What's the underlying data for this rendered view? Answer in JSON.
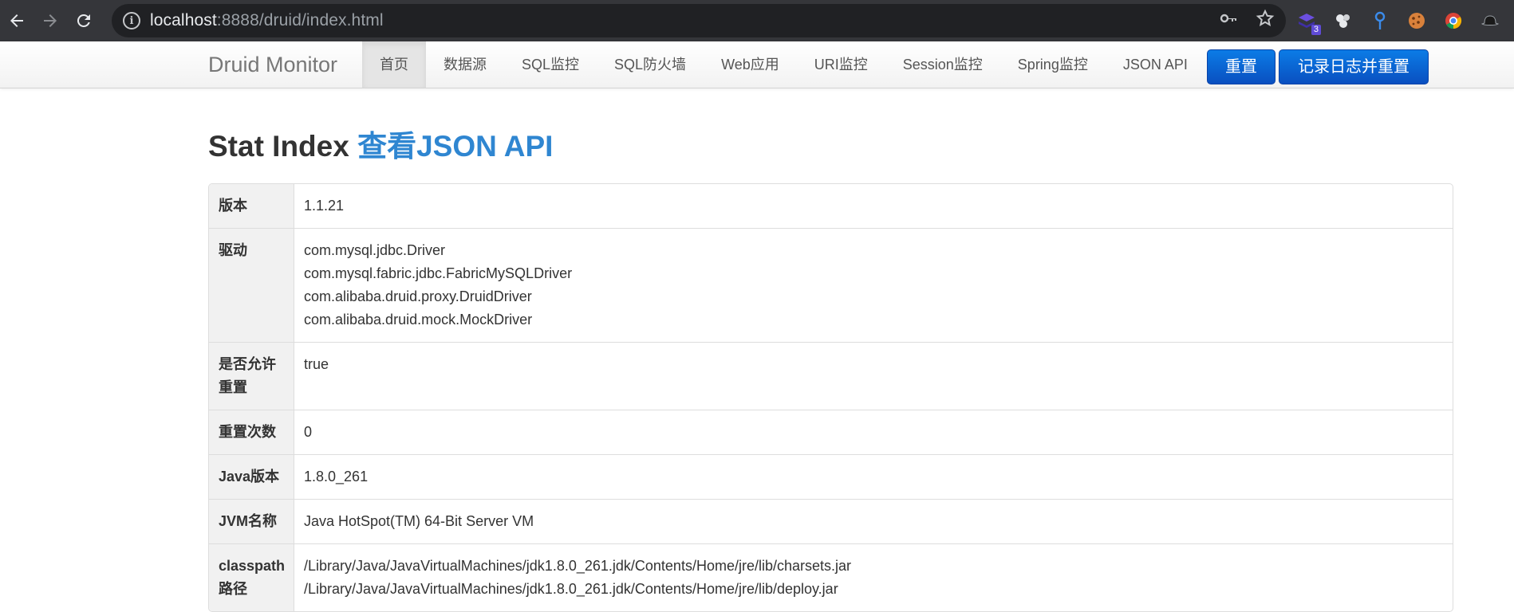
{
  "browser": {
    "url_host": "localhost",
    "url_rest": ":8888/druid/index.html",
    "extension_badge": "3",
    "icons": [
      "back-arrow-icon",
      "forward-arrow-icon",
      "reload-icon",
      "info-icon",
      "key-icon",
      "star-icon"
    ]
  },
  "navbar": {
    "brand": "Druid Monitor",
    "items": [
      {
        "label": "首页",
        "active": true
      },
      {
        "label": "数据源"
      },
      {
        "label": "SQL监控"
      },
      {
        "label": "SQL防火墙"
      },
      {
        "label": "Web应用"
      },
      {
        "label": "URI监控"
      },
      {
        "label": "Session监控"
      },
      {
        "label": "Spring监控"
      },
      {
        "label": "JSON API"
      }
    ],
    "reset_label": "重置",
    "log_reset_label": "记录日志并重置"
  },
  "page": {
    "title": "Stat Index",
    "title_link": "查看JSON API"
  },
  "stats": {
    "version_key": "版本",
    "version": "1.1.21",
    "drivers_key": "驱动",
    "drivers": [
      "com.mysql.jdbc.Driver",
      "com.mysql.fabric.jdbc.FabricMySQLDriver",
      "com.alibaba.druid.proxy.DruidDriver",
      "com.alibaba.druid.mock.MockDriver"
    ],
    "reset_enable_key_1": "是否允许",
    "reset_enable_key_2": "重置",
    "reset_enable": "true",
    "reset_count_key": "重置次数",
    "reset_count": "0",
    "java_version_key": "Java版本",
    "java_version": "1.8.0_261",
    "jvm_name_key": "JVM名称",
    "jvm_name": "Java HotSpot(TM) 64-Bit Server VM",
    "classpath_key_1": "classpath",
    "classpath_key_2": "路径",
    "classpath": [
      "/Library/Java/JavaVirtualMachines/jdk1.8.0_261.jdk/Contents/Home/jre/lib/charsets.jar",
      "/Library/Java/JavaVirtualMachines/jdk1.8.0_261.jdk/Contents/Home/jre/lib/deploy.jar"
    ]
  },
  "colors": {
    "chrome_bg": "#35363a",
    "omnibox_bg": "#202124",
    "primary_button": "#0a5fd4",
    "link": "#2f86d1"
  }
}
